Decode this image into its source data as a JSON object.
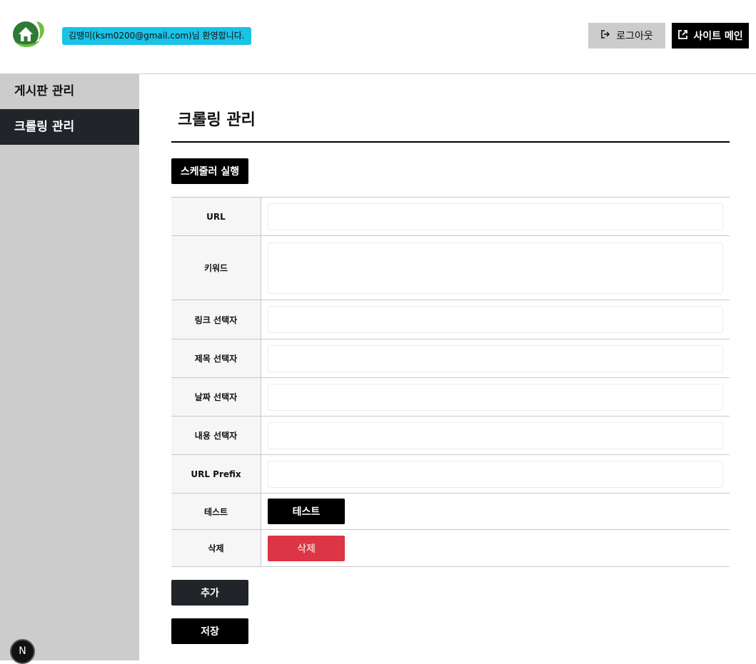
{
  "header": {
    "welcome": "김땡미(ksm0200@gmail.com)님 환영합니다.",
    "logout_label": "로그아웃",
    "site_main_label": "사이트 메인"
  },
  "sidebar": {
    "items": [
      {
        "label": "게시판 관리",
        "active": false
      },
      {
        "label": "크롤링 관리",
        "active": true
      }
    ]
  },
  "main": {
    "title": "크롤링 관리",
    "run_scheduler_label": "스케줄러 실행",
    "form": {
      "url_label": "URL",
      "url_value": "",
      "keyword_label": "키워드",
      "keyword_value": "",
      "link_selector_label": "링크 선택자",
      "link_selector_value": "",
      "title_selector_label": "제목 선택자",
      "title_selector_value": "",
      "date_selector_label": "날짜 선택자",
      "date_selector_value": "",
      "content_selector_label": "내용 선택자",
      "content_selector_value": "",
      "url_prefix_label": "URL Prefix",
      "url_prefix_value": "",
      "test_label": "테스트",
      "test_button": "테스트",
      "delete_label": "삭제",
      "delete_button": "삭제"
    },
    "add_label": "추가",
    "save_label": "저장"
  },
  "badge": {
    "letter": "N"
  },
  "colors": {
    "accent_cyan": "#19c3e6",
    "sidebar_bg": "#cccccc",
    "sidebar_active": "#212429",
    "danger": "#dc3545",
    "logo_green": "#3a8a3a"
  },
  "icons": {
    "logo": "house-leaf-logo",
    "logout": "logout-icon",
    "external": "external-link-icon"
  }
}
